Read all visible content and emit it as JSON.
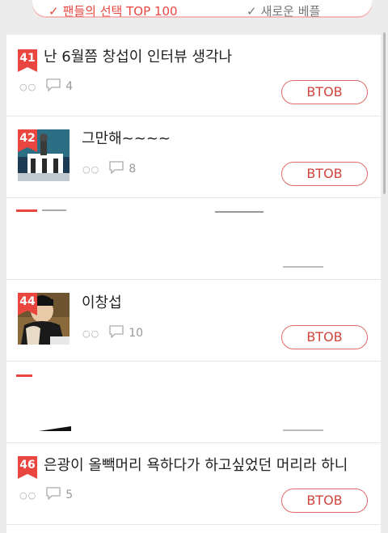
{
  "tabs": {
    "top": "팬들의 선택 TOP 100",
    "new": "새로운 베플"
  },
  "items": [
    {
      "rank": "41",
      "title": "난 6월쯤 창섭이 인터뷰 생각나",
      "comments": "4",
      "tag": "BTOB"
    },
    {
      "rank": "42",
      "title": "그만해~~~~",
      "comments": "8",
      "tag": "BTOB"
    },
    {
      "rank": "44",
      "title": "이창섭",
      "comments": "10",
      "tag": "BTOB"
    },
    {
      "rank": "46",
      "title": "은광이 올빽머리 욕하다가 하고싶었던 머리라 하니",
      "comments": "5",
      "tag": "BTOB"
    }
  ],
  "colors": {
    "accent": "#e8463f",
    "tag_border": "#e06a6a",
    "tag_text": "#d2453e"
  },
  "icons": {
    "views": "eyes-icon",
    "comments": "comment-bubble-icon",
    "selected": "check-icon"
  }
}
